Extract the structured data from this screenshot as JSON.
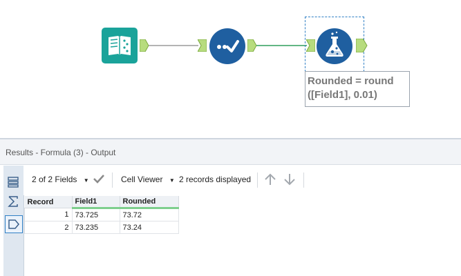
{
  "canvas": {
    "tools": [
      {
        "name": "input-data-tool",
        "icon": "book-icon",
        "color": "#1aa39a"
      },
      {
        "name": "select-tool",
        "icon": "checkmark-icon",
        "color": "#1f5fa0"
      },
      {
        "name": "formula-tool",
        "icon": "flask-icon",
        "color": "#1f5fa0"
      }
    ],
    "tooltip": {
      "line1": "Rounded = round",
      "line2": "([Field1], 0.01)"
    }
  },
  "results": {
    "title": "Results - Formula (3) - Output",
    "toolbar": {
      "fields_label": "2 of 2 Fields",
      "cell_viewer_label": "Cell Viewer",
      "records_label": "2 records displayed"
    },
    "table": {
      "headers": [
        "Record",
        "Field1",
        "Rounded"
      ],
      "rows": [
        [
          "1",
          "73.725",
          "73.72"
        ],
        [
          "2",
          "73.235",
          "73.24"
        ]
      ]
    }
  },
  "colors": {
    "connector_green": "#2e9e5b",
    "anchor_green": "#b7dc7e",
    "select_blue": "#2f7fc4"
  }
}
